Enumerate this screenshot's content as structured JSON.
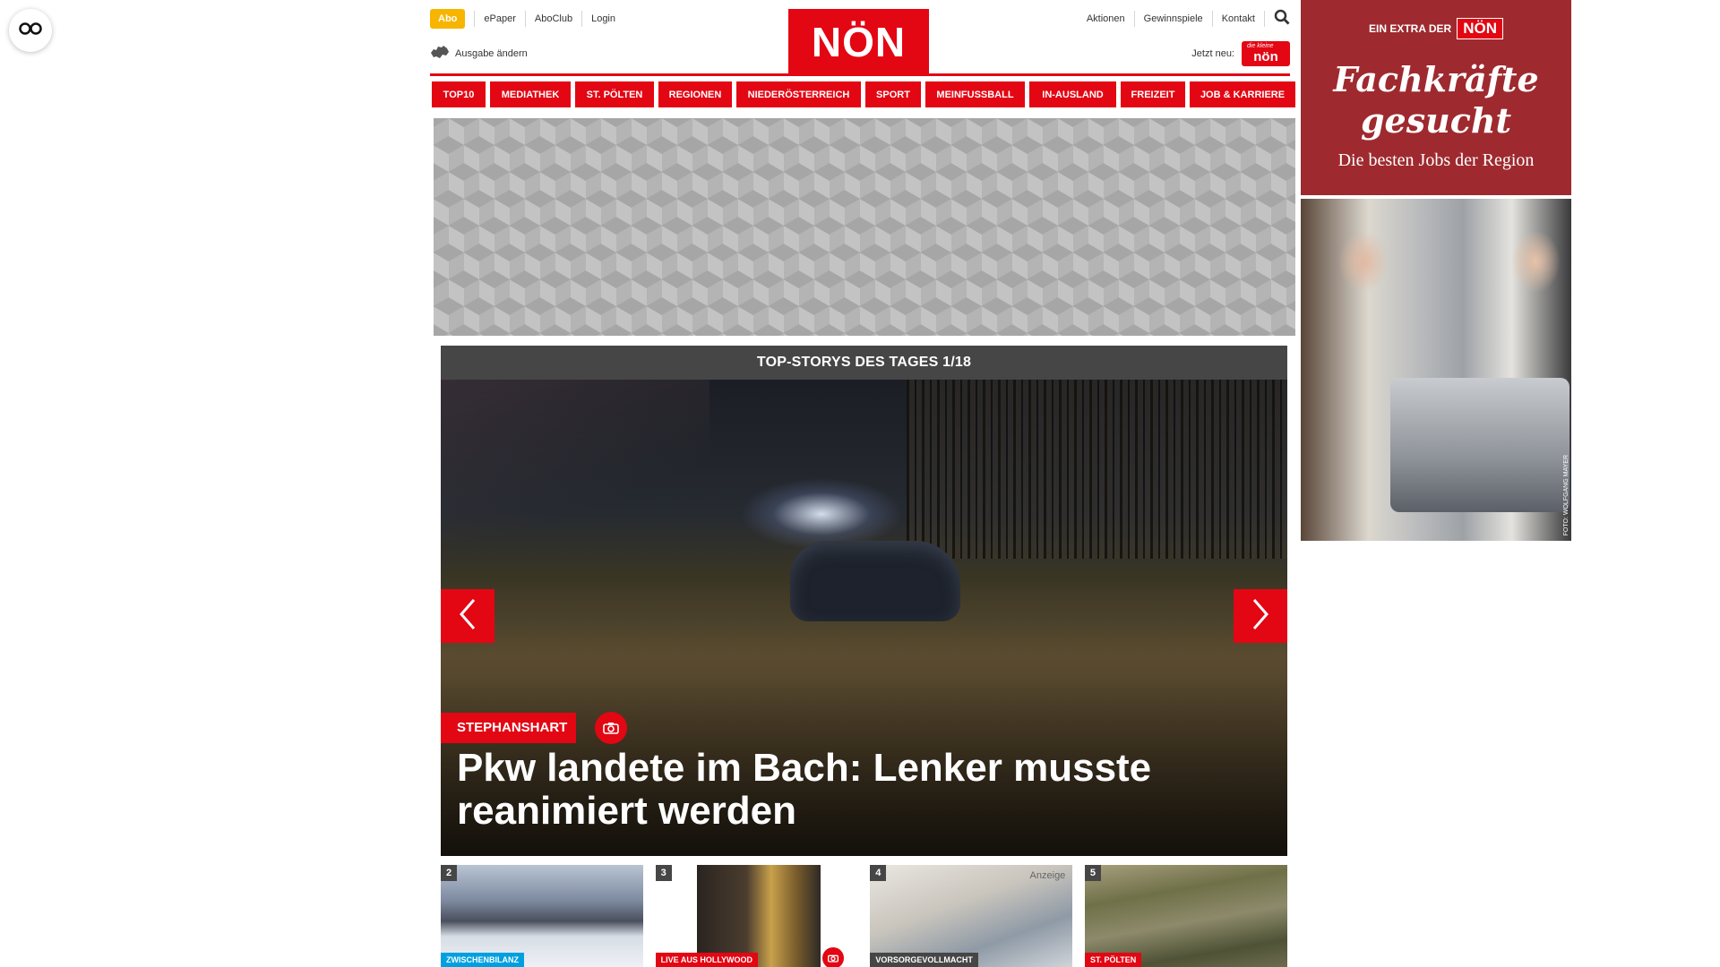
{
  "top_bar": {
    "abo_label": "Abo",
    "links": [
      "ePaper",
      "AboClub",
      "Login"
    ],
    "edition_label": "Ausgabe ändern"
  },
  "logo": {
    "text": "NÖN"
  },
  "right_bar": {
    "links": [
      "Aktionen",
      "Gewinnspiele",
      "Kontakt"
    ],
    "jetzt_label": "Jetzt neu:",
    "jetzt_badge_small": "die kleine",
    "jetzt_badge_text": "nön"
  },
  "nav": {
    "items": [
      "TOP10",
      "MEDIATHEK",
      "ST. PÖLTEN",
      "REGIONEN",
      "NIEDERÖSTERREICH",
      "SPORT",
      "MEINFUSSBALL",
      "IN-AUSLAND",
      "FREIZEIT",
      "JOB & KARRIERE"
    ]
  },
  "carousel": {
    "header": "TOP-STORYS DES TAGES 1/18",
    "tag": "STEPHANSHART",
    "title": "Pkw landete im Bach: Lenker musste reanimiert werden"
  },
  "thumbs": [
    {
      "num": "2",
      "tag": "ZWISCHENBILANZ",
      "tag_color": "#00a0e0"
    },
    {
      "num": "3",
      "tag": "LIVE AUS HOLLYWOOD",
      "tag_color": "#e30613"
    },
    {
      "num": "4",
      "tag": "VORSORGEVOLLMACHT",
      "tag_color": "#464646",
      "anzeige": "Anzeige"
    },
    {
      "num": "5",
      "tag": "ST. PÖLTEN",
      "tag_color": "#e30613"
    }
  ],
  "side_ad": {
    "extra_label": "EIN EXTRA DER",
    "extra_logo": "NÖN",
    "headline_1": "Fachkräfte",
    "headline_2": "gesucht",
    "subline": "Die besten Jobs der Region",
    "credit": "FOTO: WOLFGANG MAYER"
  },
  "colors": {
    "brand_red": "#e30613",
    "abo_yellow": "#f7b500",
    "header_grey": "#464646",
    "ad_red": "#9e2a2f"
  },
  "icons": [
    "accessibility-glasses-icon",
    "map-outline-icon",
    "search-icon",
    "chevron-left-icon",
    "chevron-right-icon",
    "camera-icon"
  ]
}
